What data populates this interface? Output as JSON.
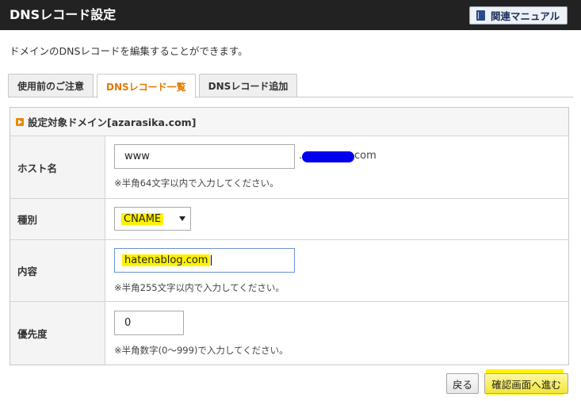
{
  "header": {
    "title": "DNSレコード設定",
    "manual_label": "関連マニュアル"
  },
  "description": "ドメインのDNSレコードを編集することができます。",
  "tabs": [
    {
      "label": "使用前のご注意",
      "active": false
    },
    {
      "label": "DNSレコード一覧",
      "active": true
    },
    {
      "label": "DNSレコード追加",
      "active": false
    }
  ],
  "section": {
    "title": "設定対象ドメイン[azarasika.com]"
  },
  "form": {
    "host": {
      "label": "ホスト名",
      "value": "www",
      "domain_prefix": ".",
      "domain_suffix": "com",
      "hint": "※半角64文字以内で入力してください。"
    },
    "type": {
      "label": "種別",
      "value": "CNAME"
    },
    "content": {
      "label": "内容",
      "value": "hatenablog.com",
      "hint": "※半角255文字以内で入力してください。"
    },
    "priority": {
      "label": "優先度",
      "value": "0",
      "hint": "※半角数字(0〜999)で入力してください。"
    }
  },
  "buttons": {
    "back": "戻る",
    "next": "確認画面へ進む"
  },
  "colors": {
    "header_bg": "#222222",
    "active_tab": "#e07a00",
    "highlight": "#fff200",
    "redaction": "#0000ee"
  }
}
